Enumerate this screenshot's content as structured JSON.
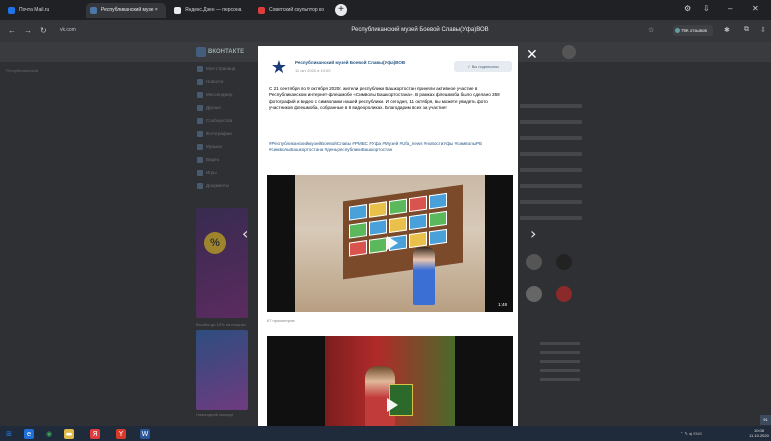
{
  "browser": {
    "tabs": [
      {
        "label": "Почта Mail.ru",
        "favicon_color": "#1e73e8"
      },
      {
        "label": "Республиканский музе ×",
        "favicon_color": "#4a76a8"
      },
      {
        "label": "Яндекс.Дзен — персона",
        "favicon_color": "#e8eaed"
      },
      {
        "label": "Советский скульптор ко",
        "favicon_color": "#e03c3c"
      }
    ],
    "new_tab": "+",
    "window_controls": [
      "⚙",
      "⇩",
      "–",
      "✕"
    ],
    "url": "vk.com",
    "page_title": "Республиканский музей Боевой Славы(Уфа)ВОВ",
    "likes_label": "75К отзывов",
    "nav": {
      "back": "←",
      "forward": "→",
      "reload": "↻"
    }
  },
  "background": {
    "logo": "ВКОНТАКТЕ",
    "left_label": "Республиканский",
    "sidebar_items": [
      "Моя страница",
      "Новости",
      "Мессенджер",
      "Друзья",
      "Сообщества",
      "Фотографии",
      "Музыка",
      "Видео",
      "Игры",
      "Документы"
    ],
    "ad1_text": "Кешбэк до 10% на покупки",
    "ad2_text": "Новогодний концерт"
  },
  "modal": {
    "close": "✕",
    "prev": "‹",
    "next": "›",
    "author": "Республиканский музей Боевой Славы(Уфа)ВОВ",
    "date": "11 окт 2020 в 10:00",
    "subscribe_label": "✓ Вы подписаны",
    "text": "С 21 сентября по 9 октября 2020г. жители республики Башкортостан приняли активное участие в Республиканском интернет-флешмобе «Символы Башкортостана». В рамках флешмоба было сделано 359 фотографий и видео с символами нашей республики. И сегодня, 11 октября, вы можете увидеть фото участников флешмоба, собранные в 6 видеороликах. Благодарим всех за участие!",
    "tags": "#РеспубликанскиймузейБоевойСлавы #РМБС #Уфа #Музей #Ufa_news #новостиУфы #символыРБ #символыБашкортостана #деньреспубликиБашкортостан",
    "video1_duration": "1:48",
    "video1_views": "67 просмотров"
  },
  "taskbar": {
    "icons": [
      {
        "name": "start",
        "glyph": "⊞",
        "color": "#2a7ae2"
      },
      {
        "name": "edge",
        "glyph": "e",
        "color": "#1e6fd9"
      },
      {
        "name": "chrome",
        "glyph": "◉",
        "color": "#3aa655"
      },
      {
        "name": "explorer",
        "glyph": "▬",
        "color": "#e0b84a"
      },
      {
        "name": "yandex",
        "glyph": "Я",
        "color": "#e03c3c"
      },
      {
        "name": "yandex-browser",
        "glyph": "Y",
        "color": "#d83a2a"
      },
      {
        "name": "word",
        "glyph": "W",
        "color": "#2b579a"
      }
    ],
    "time": "10:08",
    "date": "11.10.2020",
    "tray": "⌃ ✎ ◂) ENG",
    "badge": "91"
  }
}
